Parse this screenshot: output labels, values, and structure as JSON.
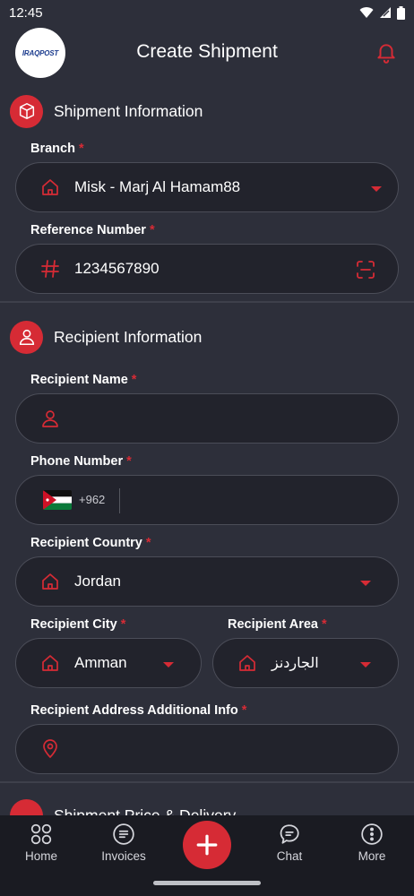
{
  "status": {
    "time": "12:45"
  },
  "header": {
    "logo_text_a": "IRAQPOST",
    "title": "Create Shipment"
  },
  "shipment_info": {
    "title": "Shipment Information",
    "branch_label": "Branch",
    "branch_value": "Misk - Marj Al Hamam88",
    "reference_label": "Reference Number",
    "reference_value": "1234567890"
  },
  "recipient_info": {
    "title": "Recipient Information",
    "name_label": "Recipient Name",
    "name_value": "",
    "phone_label": "Phone Number",
    "dial_code": "+962",
    "phone_value": "",
    "country_label": "Recipient Country",
    "country_value": "Jordan",
    "city_label": "Recipient City",
    "city_value": "Amman",
    "area_label": "Recipient Area",
    "area_value": "الجاردنز",
    "address_label": "Recipient Address Additional Info",
    "address_value": ""
  },
  "next_section": {
    "title": "Shipment Price & Delivery"
  },
  "required_mark": "*",
  "bottom_nav": {
    "home": "Home",
    "invoices": "Invoices",
    "chat": "Chat",
    "more": "More"
  },
  "colors": {
    "accent": "#d62b35",
    "background": "#2d2f3a",
    "field": "#22232c",
    "nav": "#1a1b22"
  }
}
